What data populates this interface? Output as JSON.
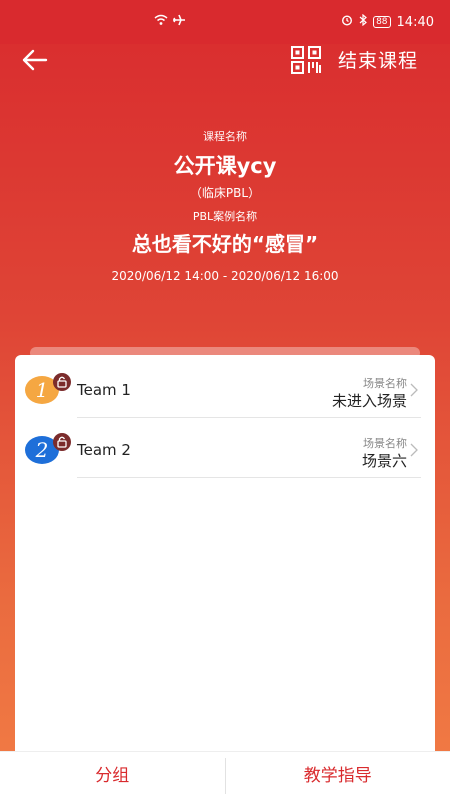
{
  "status_bar": {
    "time": "14:40",
    "battery": "88"
  },
  "header": {
    "end_course_label": "结束课程"
  },
  "course": {
    "name_label": "课程名称",
    "name": "公开课ycy",
    "subtitle": "（临床PBL）",
    "case_label": "PBL案例名称",
    "case_name": "总也看不好的“感冒”",
    "time_range": "2020/06/12 14:00 - 2020/06/12 16:00"
  },
  "teams": [
    {
      "number": "1",
      "name": "Team 1",
      "scene_label": "场景名称",
      "scene_value": "未进入场景",
      "badge_color": "#f5a742"
    },
    {
      "number": "2",
      "name": "Team 2",
      "scene_label": "场景名称",
      "scene_value": "场景六",
      "badge_color": "#1e6fd9"
    }
  ],
  "bottom_tabs": {
    "left": "分组",
    "right": "教学指导"
  }
}
